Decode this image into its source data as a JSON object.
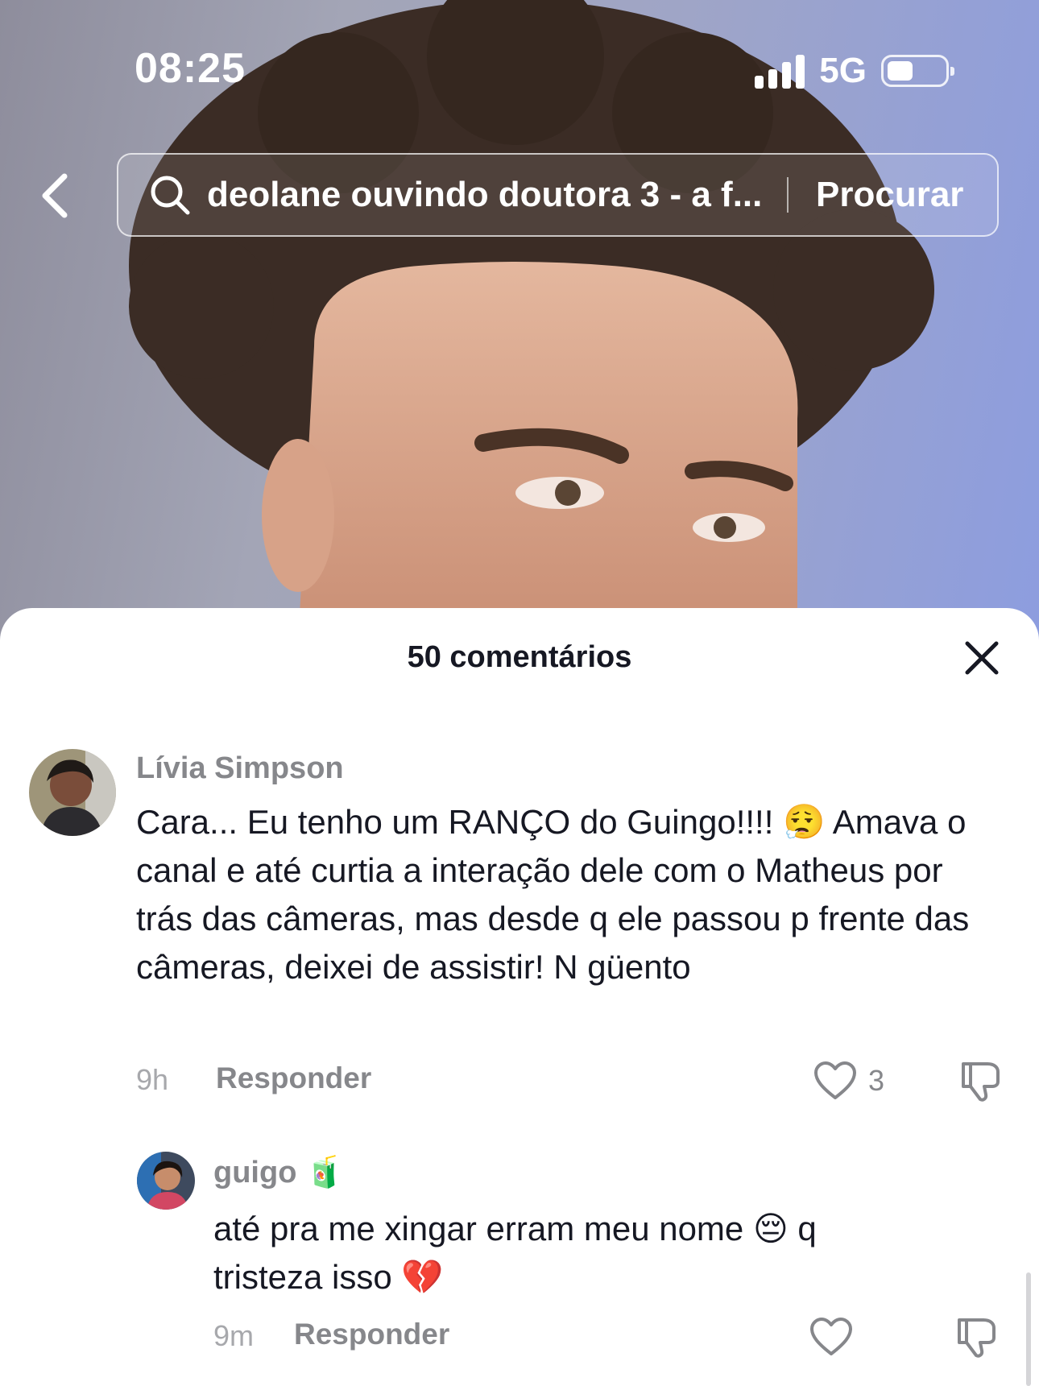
{
  "status_bar": {
    "time": "08:25",
    "network": "5G"
  },
  "search": {
    "query": "deolane ouvindo doutora 3 - a f...",
    "button_label": "Procurar"
  },
  "comments_sheet": {
    "title": "50 comentários",
    "comments": [
      {
        "username": "Lívia Simpson",
        "text": "Cara... Eu tenho um RANÇO do Guingo!!!! 😮‍💨 Amava o canal e até curtia a interação dele com o Matheus por trás das câmeras, mas desde q ele passou p frente das câmeras, deixei de assistir! N güento",
        "time": "9h",
        "reply_label": "Responder",
        "like_count": "3"
      }
    ],
    "replies": [
      {
        "username": "guigo",
        "username_emoji": "🧃",
        "text": "até pra me xingar erram meu nome 😔 q tristeza isso 💔",
        "time": "9m",
        "reply_label": "Responder"
      }
    ]
  },
  "colors": {
    "primary_text": "#161823",
    "secondary_text": "#86878b",
    "sheet_bg": "#ffffff"
  }
}
